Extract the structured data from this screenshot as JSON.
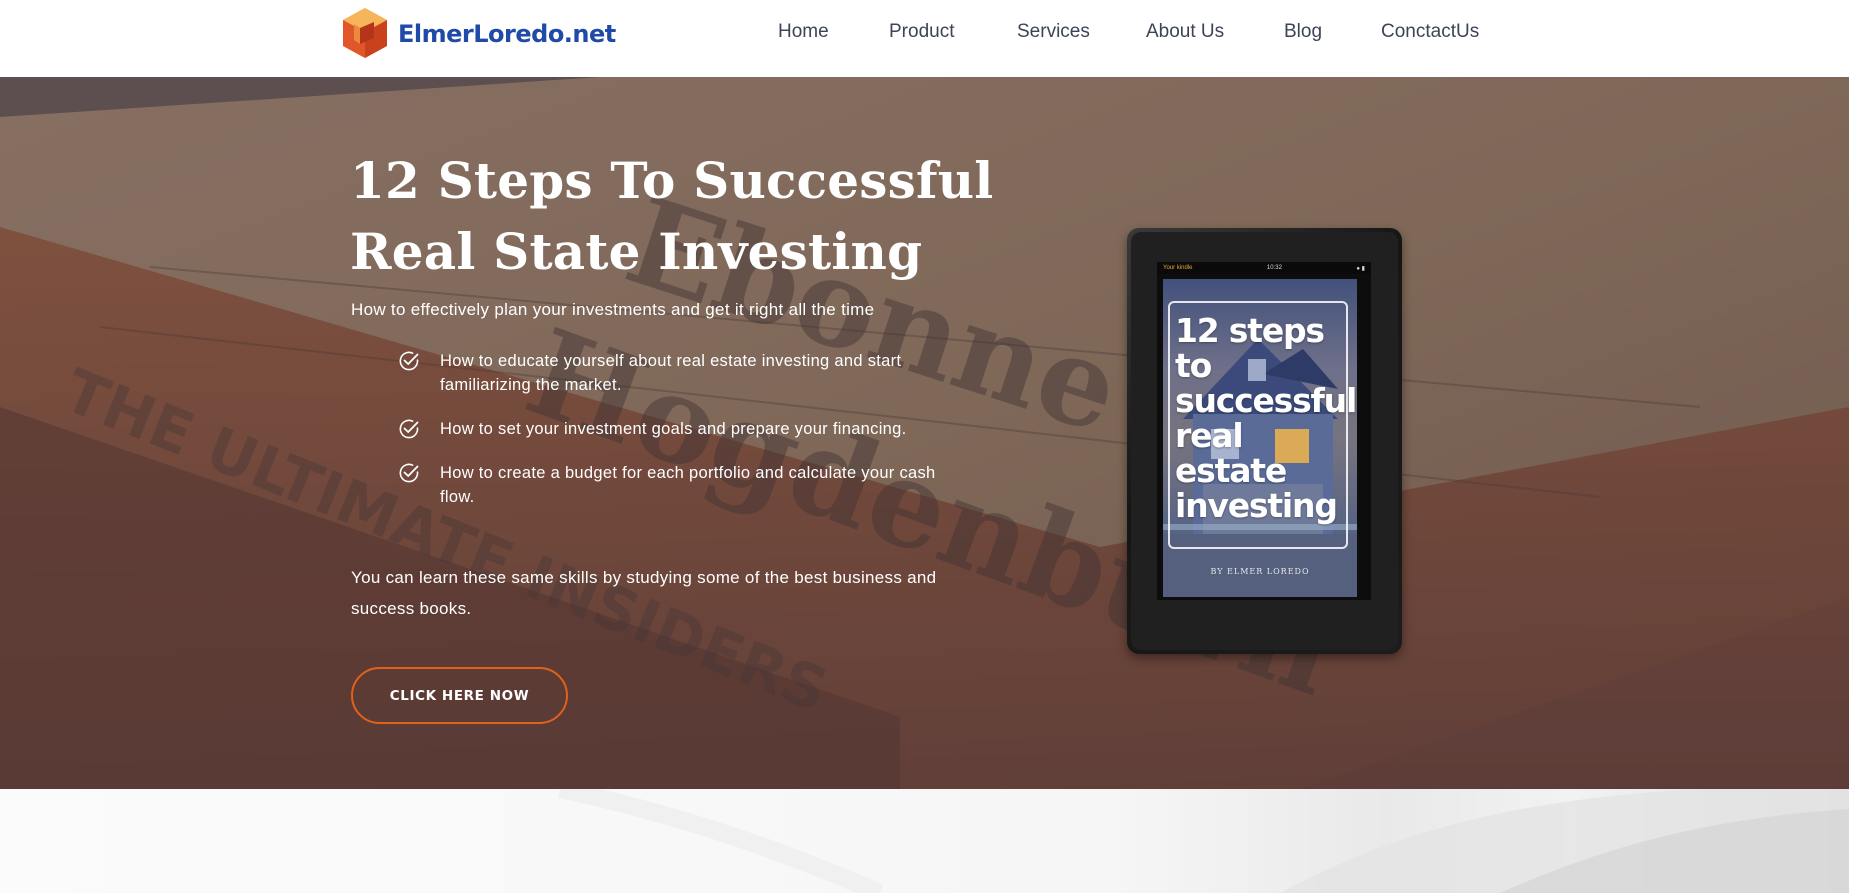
{
  "site": {
    "logo_text": "ElmerLoredo.net"
  },
  "nav": {
    "items": [
      {
        "label": "Home"
      },
      {
        "label": "Product"
      },
      {
        "label": "Services"
      },
      {
        "label": "About Us"
      },
      {
        "label": "Blog"
      },
      {
        "label": "ConctactUs"
      }
    ]
  },
  "hero": {
    "title_line1": "12 Steps To Successful",
    "title_line2": "Real State Investing",
    "subtitle": "How to effectively plan your investments and get it right all the time",
    "checklist": [
      {
        "text": "How to educate yourself about real estate investing and start familiarizing the market."
      },
      {
        "text": "How to set your investment goals and prepare your financing."
      },
      {
        "text": "How to create a budget for each portfolio and calculate your cash flow."
      }
    ],
    "paragraph": "You can learn these same skills by studying some of the best business and success books.",
    "cta_label": "CLICK HERE NOW",
    "cta_border_color": "#e0601c"
  },
  "tablet": {
    "status_left": "Your kindle",
    "status_time": "10:32",
    "cover_title_lines": [
      "12 steps",
      "to",
      "successful",
      "real",
      "estate",
      "investing"
    ],
    "cover_author": "BY ELMER LOREDO"
  },
  "colors": {
    "brand_blue": "#1f4aa8",
    "logo_orange": "#e2572a",
    "nav_text": "#3c4456"
  },
  "icons": {
    "logo": "cube-logo-icon",
    "check": "check-circle-icon"
  }
}
